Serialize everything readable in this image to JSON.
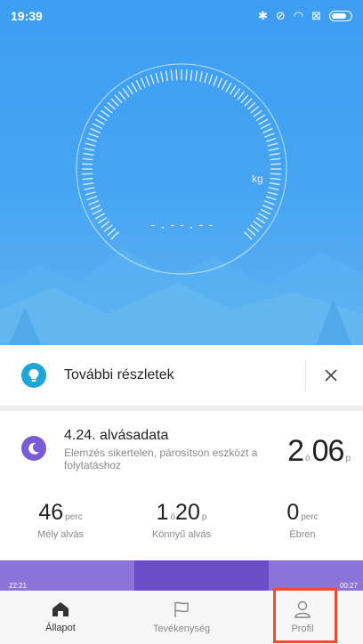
{
  "status_bar": {
    "time": "19:39"
  },
  "gauge": {
    "unit": "kg",
    "value": "-.--.--"
  },
  "details_card": {
    "label": "További részletek"
  },
  "sleep_card": {
    "title": "4.24. alvásadata",
    "subtitle": "Elemzés sikertelen, párosítson eszközt a folytatáshoz",
    "total_hours": "2",
    "hours_unit": "ó",
    "total_minutes": "06",
    "minutes_unit": "p",
    "stats": [
      {
        "value": "46",
        "unit": "perc",
        "label": "Mély alvás"
      },
      {
        "value": "1",
        "unit_mid": "ó",
        "value2": "20",
        "unit": "p",
        "label": "Könnyű alvás"
      },
      {
        "value": "0",
        "unit": "perc",
        "label": "Ébren"
      }
    ]
  },
  "timeline": {
    "start": "22:21",
    "end": "00:27",
    "segments": [
      {
        "fraction": 0.37,
        "kind": "light",
        "color": "#8b73d9"
      },
      {
        "fraction": 0.37,
        "kind": "deep",
        "color": "#6a4cc6"
      },
      {
        "fraction": 0.26,
        "kind": "light",
        "color": "#8b73d9"
      }
    ]
  },
  "bottom_nav": {
    "items": [
      {
        "label": "Állapot",
        "icon": "home-icon",
        "active": true
      },
      {
        "label": "Tevékenység",
        "icon": "flag-icon",
        "active": false
      },
      {
        "label": "Profil",
        "icon": "person-icon",
        "active": false
      }
    ]
  },
  "colors": {
    "hero_blue": "#3d9df1",
    "accent_purple": "#7a5bd6",
    "highlight_red": "#ef4a2c"
  }
}
